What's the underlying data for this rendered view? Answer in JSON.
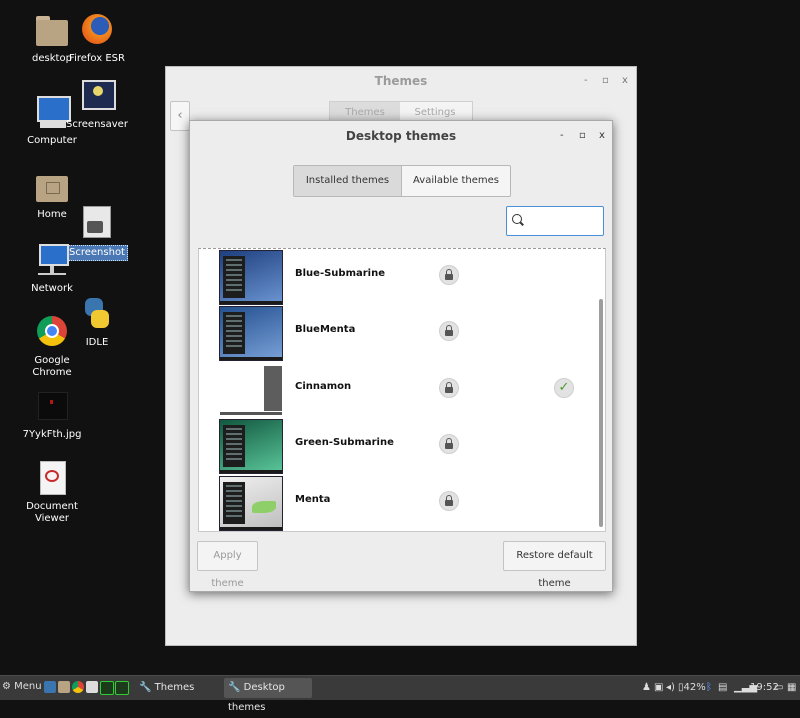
{
  "desktop": {
    "icons": [
      {
        "label": "desktop"
      },
      {
        "label": "Firefox ESR"
      },
      {
        "label": "Computer"
      },
      {
        "label": "Screensaver"
      },
      {
        "label": "Home"
      },
      {
        "label": "Screenshot"
      },
      {
        "label": "Network"
      },
      {
        "label": "IDLE"
      },
      {
        "label": "Google Chrome"
      },
      {
        "label": "7YykFth.jpg"
      },
      {
        "label": "Document Viewer"
      }
    ]
  },
  "back_window": {
    "title": "Themes",
    "tabs": [
      "Themes",
      "Settings"
    ],
    "back_glyph": "‹",
    "controls": [
      "-",
      "▫",
      "x"
    ]
  },
  "dialog": {
    "title": "Desktop themes",
    "controls": [
      "-",
      "▫",
      "x"
    ],
    "tabs": [
      {
        "label": "Installed themes",
        "active": true
      },
      {
        "label": "Available themes (online)",
        "active": false
      }
    ],
    "search": {
      "value": "",
      "placeholder": ""
    },
    "themes": [
      {
        "name": "Blue-Submarine",
        "colors": [
          "#2b4f93",
          "#5a85c6"
        ],
        "locked": true,
        "active": false
      },
      {
        "name": "BlueMenta",
        "colors": [
          "#2e5fa8",
          "#6d94cf"
        ],
        "locked": true,
        "active": false
      },
      {
        "name": "Cinnamon",
        "colors": [
          "#ffffff",
          "#666666"
        ],
        "locked": true,
        "active": true
      },
      {
        "name": "Green-Submarine",
        "colors": [
          "#1f7a5a",
          "#58c49a"
        ],
        "locked": true,
        "active": false
      },
      {
        "name": "Menta",
        "colors": [
          "#dcdcdc",
          "#9fd97f"
        ],
        "locked": true,
        "active": false
      }
    ],
    "buttons": {
      "apply": "Apply theme",
      "restore": "Restore default theme"
    }
  },
  "taskbar": {
    "menu_label": "Menu",
    "tasks": [
      {
        "label": "Themes",
        "active": false
      },
      {
        "label": "Desktop themes",
        "active": true
      }
    ],
    "battery": "42%",
    "clock": "19:52"
  }
}
